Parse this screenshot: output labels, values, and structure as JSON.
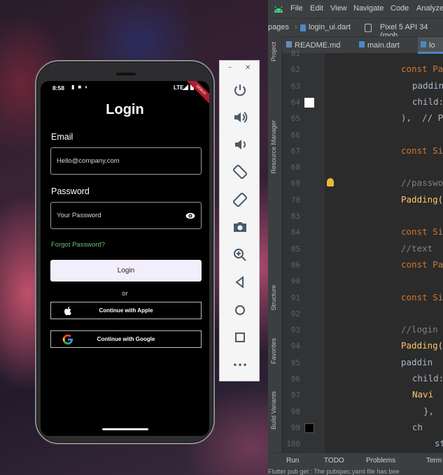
{
  "phone_app": {
    "status": {
      "time": "8:58",
      "network": "LTE",
      "debug_banner": "DEBUG"
    },
    "title": "Login",
    "email_label": "Email",
    "email_placeholder": "Hello@company.com",
    "password_label": "Password",
    "password_placeholder": "Your Password",
    "forgot_password": "Forgot Password?",
    "login_button": "Login",
    "or_text": "or",
    "apple_button": "Continue with Apple",
    "google_button": "Continue with Google",
    "colors": {
      "forgot_link": "#6cc070",
      "login_button_bg": "#f3eefb",
      "screen_bg": "#000000"
    }
  },
  "emulator_toolbar": {
    "window_controls": [
      "–",
      "×"
    ],
    "buttons": [
      "power-icon",
      "volume-up-icon",
      "volume-down-icon",
      "rotate-left-icon",
      "rotate-right-icon",
      "camera-icon",
      "zoom-icon",
      "back-icon",
      "home-icon",
      "overview-icon",
      "more-icon"
    ],
    "more_label": "•••"
  },
  "ide": {
    "menu": [
      "File",
      "Edit",
      "View",
      "Navigate",
      "Code",
      "Analyze"
    ],
    "breadcrumb": {
      "folder": "pages",
      "file": "login_ui.dart",
      "device": "Pixel 5 API 34 (mob"
    },
    "tabs": [
      "README.md",
      "main.dart",
      "lo"
    ],
    "side_panels": [
      "Project",
      "Resource Manager",
      "Structure",
      "Favorites",
      "Build Variants"
    ],
    "lines": [
      {
        "num": "81",
        "text": ""
      },
      {
        "num": "62",
        "text": "const Pa"
      },
      {
        "num": "63",
        "text": "paddin"
      },
      {
        "num": "64",
        "text": "child:"
      },
      {
        "num": "65",
        "text": "),  // P"
      },
      {
        "num": "66",
        "text": ""
      },
      {
        "num": "67",
        "text": "const Si"
      },
      {
        "num": "68",
        "text": ""
      },
      {
        "num": "69",
        "text": "//passwo"
      },
      {
        "num": "70",
        "text": "Padding("
      },
      {
        "num": "83",
        "text": ""
      },
      {
        "num": "84",
        "text": "const Si"
      },
      {
        "num": "85",
        "text": "//text"
      },
      {
        "num": "86",
        "text": "const Pa"
      },
      {
        "num": "90",
        "text": ""
      },
      {
        "num": "91",
        "text": "const Si"
      },
      {
        "num": "92",
        "text": ""
      },
      {
        "num": "93",
        "text": "//login"
      },
      {
        "num": "94",
        "text": "Padding("
      },
      {
        "num": "95",
        "text": "paddin"
      },
      {
        "num": "96",
        "text": "child:"
      },
      {
        "num": "97",
        "text": "Navi"
      },
      {
        "num": "98",
        "text": "},"
      },
      {
        "num": "99",
        "text": "ch"
      },
      {
        "num": "100",
        "text": "styl"
      }
    ],
    "bottom_tools": [
      "Run",
      "TODO",
      "Problems",
      "Term"
    ],
    "status_message": "Flutter pub get : The pubspec.yaml file has bee"
  }
}
